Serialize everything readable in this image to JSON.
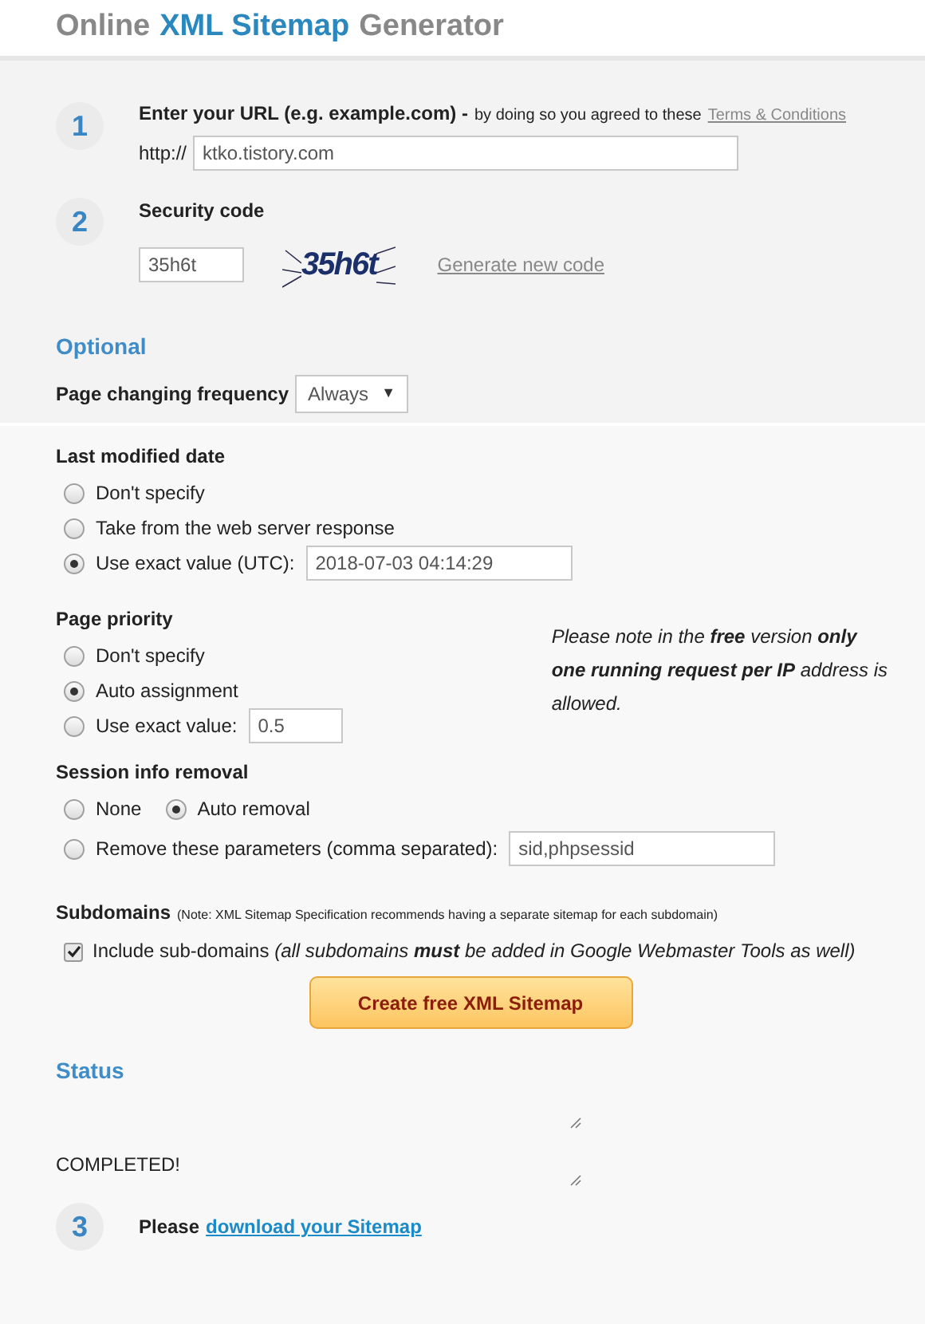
{
  "title": {
    "part_1": "Online",
    "part_2": "XML Sitemap",
    "part_3": "Generator"
  },
  "step_1": {
    "number": "1",
    "heading": "Enter your URL (e.g. example.com) -",
    "note": "by doing so you agreed to these",
    "link": "Terms & Conditions",
    "prefix": "http://",
    "value": "ktko.tistory.com"
  },
  "step_2": {
    "number": "2",
    "heading": "Security code",
    "value": "35h6t",
    "captcha": "35h6t",
    "link": "Generate new code"
  },
  "optional": {
    "heading": "Optional",
    "frequency_label": "Page changing frequency",
    "frequency_value": "Always",
    "caret": "▼"
  },
  "last_modified": {
    "heading": "Last modified date",
    "options": [
      {
        "label": "Don't specify",
        "selected": false
      },
      {
        "label": "Take from the web server response",
        "selected": false
      },
      {
        "label": "Use exact value (UTC):",
        "selected": true,
        "value": "2018-07-03 04:14:29"
      }
    ]
  },
  "priority": {
    "heading": "Page priority",
    "options": [
      {
        "label": "Don't specify",
        "selected": false
      },
      {
        "label": "Auto assignment",
        "selected": true
      },
      {
        "label": "Use exact value:",
        "selected": false,
        "value": "0.5"
      }
    ],
    "notice": "Please note in the **free** version **only one running request per IP** address is allowed."
  },
  "session": {
    "heading": "Session info removal",
    "options": [
      {
        "label": "None",
        "selected": false
      },
      {
        "label": "Auto removal",
        "selected": true
      },
      {
        "label": "Remove these parameters (comma separated):",
        "selected": false,
        "value": "sid,phpsessid"
      }
    ]
  },
  "subdomains": {
    "heading": "Subdomains",
    "note": "(Note: XML Sitemap Specification recommends having a separate sitemap for each subdomain)",
    "label": "Include sub-domains",
    "checked": true,
    "hint": "(all subdomains **must** be added in Google Webmaster Tools as well)"
  },
  "create_button": "Create free XML Sitemap",
  "status": {
    "heading": "Status",
    "value": "COMPLETED!"
  },
  "step_3": {
    "number": "3",
    "text": "Please",
    "link": "download your Sitemap"
  }
}
